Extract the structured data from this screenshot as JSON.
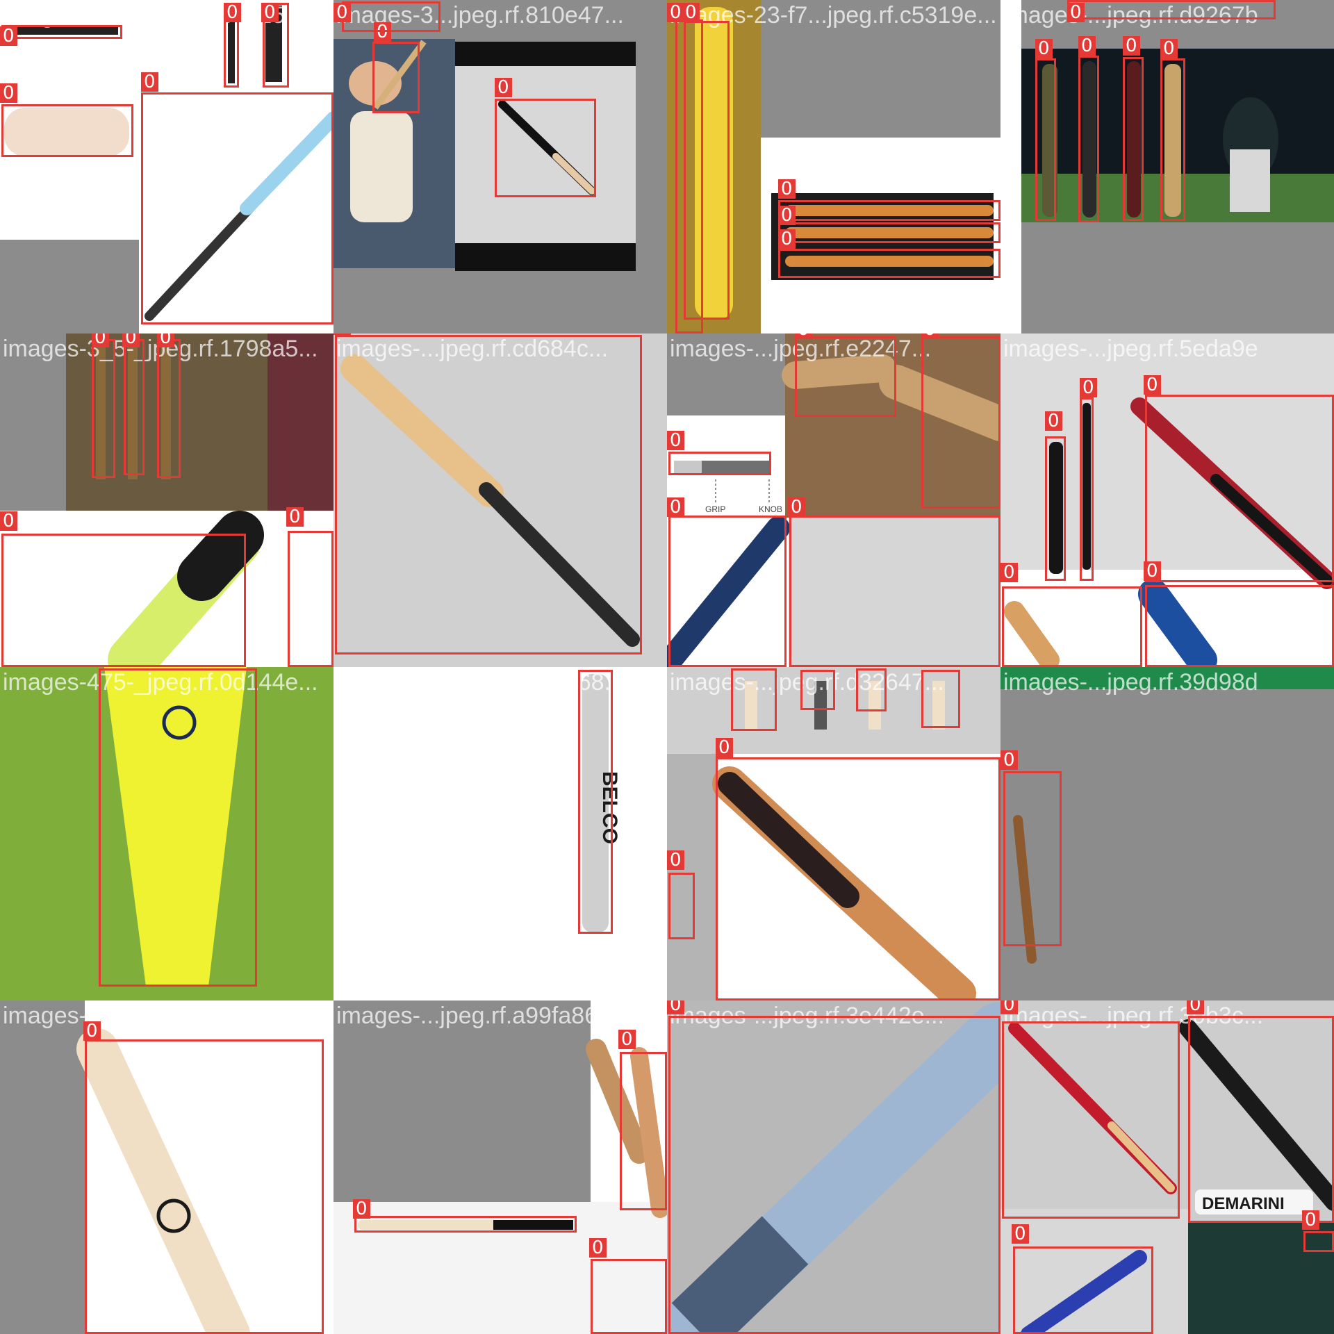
{
  "mosaic_title": "",
  "class_label": "0",
  "colors": {
    "box_stroke": "#e53935",
    "label_bg": "#e53935",
    "label_text": "#ffffff",
    "padding_gray": "#8c8c8c"
  },
  "tiles": [
    {
      "filename": "images-152-_jpeg.rf.b6325",
      "annotation_count": 5,
      "annotation_labels": [
        "0",
        "0",
        "0",
        "0",
        "0"
      ]
    },
    {
      "filename": "images-3...jpeg.rf.810e47...",
      "annotation_count": 3,
      "annotation_labels": [
        "0",
        "0",
        "0"
      ]
    },
    {
      "filename": "images-23-f7...jpeg.rf.c5319e...",
      "annotation_count": 5,
      "annotation_labels": [
        "0",
        "0",
        "0",
        "0",
        "0"
      ]
    },
    {
      "filename": "images-...jpeg.rf.d9267b",
      "annotation_count": 5,
      "annotation_labels": [
        "0",
        "0",
        "0",
        "0",
        "0"
      ]
    },
    {
      "filename": "images-3_5-_jpeg.rf.1798a5...",
      "annotation_count": 5,
      "annotation_labels": [
        "0",
        "0",
        "0",
        "0",
        "0"
      ]
    },
    {
      "filename": "images-...jpeg.rf.cd684c...",
      "annotation_count": 1,
      "annotation_labels": [
        "0"
      ]
    },
    {
      "filename": "images-...jpeg.rf.e2247...",
      "annotation_count": 5,
      "annotation_labels": [
        "0",
        "0",
        "0",
        "0",
        "0"
      ],
      "diagram_text": {
        "grip": "GRIP",
        "knob": "KNOB"
      }
    },
    {
      "filename": "images-...jpeg.rf.5eda9e",
      "annotation_count": 5,
      "annotation_labels": [
        "0",
        "0",
        "0",
        "0",
        "0"
      ]
    },
    {
      "filename": "images-475-_jpeg.rf.0d144e...",
      "annotation_count": 1,
      "annotation_labels": [
        "0"
      ]
    },
    {
      "filename": "images-...jpeg.rf.e9...fa68...",
      "annotation_count": 1,
      "annotation_labels": [
        "0"
      ],
      "product_text": "BELCO"
    },
    {
      "filename": "images-...jpeg.rf.d32647...",
      "annotation_count": 6,
      "annotation_labels": [
        "0",
        "0",
        "0",
        "0",
        "0",
        "0"
      ]
    },
    {
      "filename": "images-...jpeg.rf.39d98d",
      "annotation_count": 1,
      "annotation_labels": [
        "0"
      ]
    },
    {
      "filename": "images-480-_jpeg.rf.03fe69...",
      "annotation_count": 1,
      "annotation_labels": [
        "0"
      ]
    },
    {
      "filename": "images-...jpeg.rf.a99fa86...",
      "annotation_count": 3,
      "annotation_labels": [
        "0",
        "0",
        "0"
      ]
    },
    {
      "filename": "images-...jpeg.rf.3e442e...",
      "annotation_count": 1,
      "annotation_labels": [
        "0"
      ]
    },
    {
      "filename": "images-...jpeg.rf.30b3c...",
      "annotation_count": 4,
      "annotation_labels": [
        "0",
        "0",
        "0",
        "0"
      ],
      "product_text": "DEMARINI"
    }
  ]
}
